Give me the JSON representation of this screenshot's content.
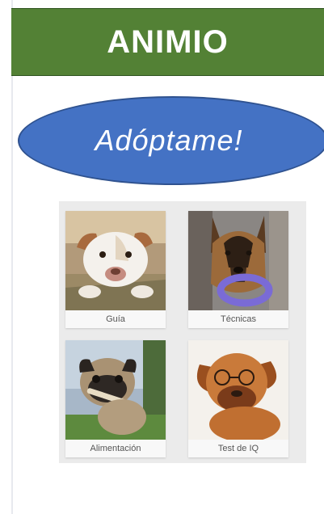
{
  "header": {
    "title": "ANIMIO",
    "color": "#538135"
  },
  "cta": {
    "label": "Adóptame!",
    "color": "#4472c4"
  },
  "cards": [
    {
      "label": "Guía",
      "icon": "pitbull-photo"
    },
    {
      "label": "Técnicas",
      "icon": "german-shepherd-photo"
    },
    {
      "label": "Alimentación",
      "icon": "pug-photo"
    },
    {
      "label": "Test de IQ",
      "icon": "bulldog-glasses-photo"
    }
  ]
}
